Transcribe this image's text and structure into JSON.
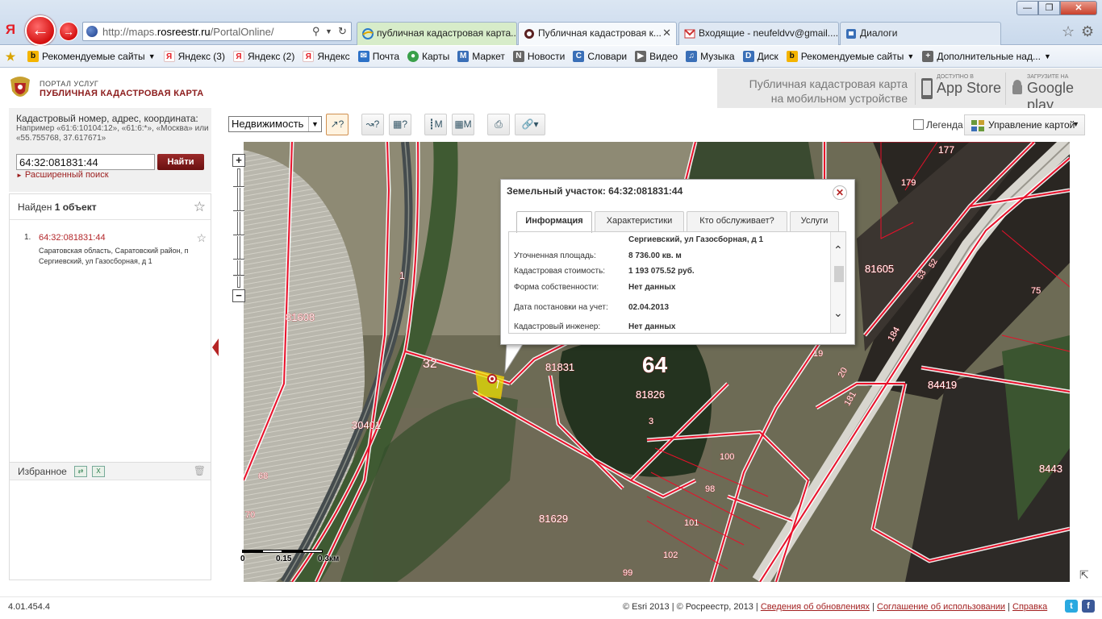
{
  "browser": {
    "yandex_logo": "Я",
    "url_prefix": "http://maps.",
    "url_domain": "rosreestr.ru",
    "url_path": "/PortalOnline/",
    "tabs": [
      {
        "label": "публичная кадастровая карта..."
      },
      {
        "label": "Публичная кадастровая к..."
      },
      {
        "label": "Входящие - neufeldvv@gmail...."
      },
      {
        "label": "Диалоги"
      }
    ],
    "bookmarks": [
      {
        "label": "Рекомендуемые сайты",
        "icon": "bing-icon",
        "dropdown": true
      },
      {
        "label": "Яндекс (3)",
        "icon": "yandex-icon"
      },
      {
        "label": "Яндекс (2)",
        "icon": "yandex-icon"
      },
      {
        "label": "Яндекс",
        "icon": "yandex-icon"
      },
      {
        "label": "Почта",
        "icon": "mail-icon"
      },
      {
        "label": "Карты",
        "icon": "maps-icon"
      },
      {
        "label": "Маркет",
        "icon": "market-icon"
      },
      {
        "label": "Новости",
        "icon": "news-icon"
      },
      {
        "label": "Словари",
        "icon": "dictionary-icon"
      },
      {
        "label": "Видео",
        "icon": "video-icon"
      },
      {
        "label": "Музыка",
        "icon": "music-icon"
      },
      {
        "label": "Диск",
        "icon": "disk-icon"
      },
      {
        "label": "Рекомендуемые сайты",
        "icon": "bing-icon",
        "dropdown": true
      },
      {
        "label": "Дополнительные над...",
        "icon": "addons-icon",
        "dropdown": true
      }
    ]
  },
  "header": {
    "portal": "ПОРТАЛ УСЛУГ",
    "title": "ПУБЛИЧНАЯ КАДАСТРОВАЯ КАРТА",
    "mobile_line1": "Публичная кадастровая карта",
    "mobile_line2": "на мобильном устройстве",
    "appstore_small": "Доступно в",
    "appstore_big": "App Store",
    "google_small": "ЗАГРУЗИТЕ НА",
    "google_big": "Google play"
  },
  "search": {
    "label": "Кадастровый номер, адрес, координата:",
    "hint": "Например «61:6:10104:12», «61:6:*», «Москва» или «55.755768, 37.617671»",
    "value": "64:32:081831:44",
    "button": "Найти",
    "advanced": "Расширенный поиск"
  },
  "results": {
    "found_prefix": "Найден",
    "found_count": "1 объект",
    "items": [
      {
        "num": "1.",
        "id": "64:32:081831:44",
        "address": "Саратовская область, Саратовский район, п Сергиевский, ул Газосборная, д 1"
      }
    ]
  },
  "favorites": {
    "label": "Избранное"
  },
  "toolbar": {
    "layer_select": "Недвижимость",
    "legend_label": "Легенда",
    "map_control": "Управление картой"
  },
  "popup": {
    "title": "Земельный участок: 64:32:081831:44",
    "tabs": [
      "Информация",
      "Характеристики",
      "Кто обслуживает?",
      "Услуги"
    ],
    "address_line": "Сергиевский, ул Газосборная, д 1",
    "rows": [
      {
        "label": "Уточненная площадь:",
        "value": "8 736.00 кв. м"
      },
      {
        "label": "Кадастровая стоимость:",
        "value": "1 193 075.52 руб."
      },
      {
        "label": "Форма собственности:",
        "value": "Нет данных"
      },
      {
        "label": "Дата постановки на учет:",
        "value": "02.04.2013"
      },
      {
        "label": "Кадастровый инженер:",
        "value": "Нет данных"
      }
    ]
  },
  "map": {
    "scale_labels": [
      "0",
      "0.15",
      "0.3км"
    ],
    "labels": [
      "177",
      "179",
      "1",
      "81608",
      "32",
      "81831",
      "64",
      "81826",
      "81605",
      "75",
      "19",
      "20",
      "184",
      "181",
      "84419",
      "3",
      "100",
      "98",
      "101",
      "102",
      "99",
      "81629",
      "30401",
      "68",
      "70",
      "8443",
      "52",
      "53"
    ]
  },
  "footer": {
    "version": "4.01.454.4",
    "copyright": "© Esri 2013 | © Росреестр, 2013 |",
    "link1": "Сведения об обновлениях",
    "sep1": "|",
    "link2": "Соглашение об использовании",
    "sep2": "|",
    "link3": "Справка"
  },
  "colors": {
    "brand": "#8c1c1c",
    "accent_red": "#b52424",
    "parcel_line": "#e8102a"
  }
}
